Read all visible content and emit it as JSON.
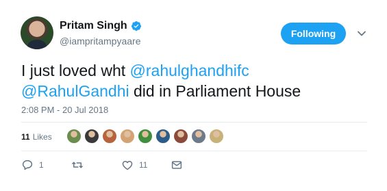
{
  "user": {
    "display_name": "Pritam Singh",
    "handle": "@iampritampyaare",
    "verified": true
  },
  "follow_button": {
    "label": "Following"
  },
  "tweet": {
    "segments": [
      {
        "text": "I just loved wht ",
        "type": "text"
      },
      {
        "text": "@rahulghandhifc",
        "type": "mention"
      },
      {
        "text": "@RahulGandhi",
        "type": "mention"
      },
      {
        "text": " did in Parliament House",
        "type": "text"
      }
    ],
    "timestamp": "2:08 PM - 20 Jul 2018"
  },
  "likes": {
    "count": "11",
    "label": "Likes",
    "avatar_colors": [
      "#6b8e4e",
      "#3a3a3a",
      "#b5643c",
      "#d4a373",
      "#3f8f3f",
      "#2c5d8a",
      "#8b4a3a",
      "#6c7a89",
      "#c9b27a"
    ]
  },
  "actions": {
    "reply_count": "1",
    "retweet_count": "",
    "like_count": "11"
  },
  "colors": {
    "accent": "#1da1f2",
    "text": "#14171a",
    "muted": "#657786"
  }
}
